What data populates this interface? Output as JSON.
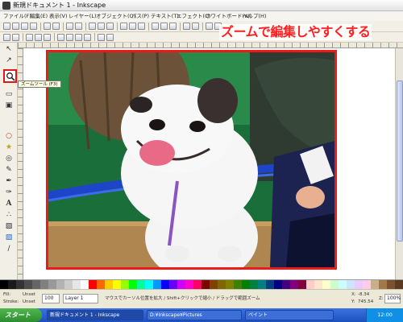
{
  "window": {
    "title": "新規ドキュメント 1 - Inkscape"
  },
  "menu": {
    "items": [
      "ファイル(F)",
      "編集(E)",
      "表示(V)",
      "レイヤー(L)",
      "オブジェクト(O)",
      "パス(P)",
      "テキスト(T)",
      "エフェクト(C)",
      "ホワイトボード(W)",
      "ヘルプ(H)"
    ]
  },
  "annotation": {
    "text": "ズームで編集しやすくする",
    "color": "#ff1f1f"
  },
  "toolbox": {
    "tools": [
      "select-icon",
      "node-edit-icon",
      "tweak-icon",
      "zoom-icon",
      "rectangle-icon",
      "box3d-icon",
      "ellipse-icon",
      "star-icon",
      "spiral-icon",
      "pencil-icon",
      "pen-icon",
      "calligraphy-icon",
      "text-icon",
      "spray-icon",
      "eraser-icon",
      "bucket-icon",
      "dropper-icon"
    ],
    "zoom_tooltip": "ズームツール (F3)"
  },
  "canvas": {
    "selection_color": "#ee1a1a",
    "image": "dog-photo"
  },
  "palette": {
    "colors": [
      "#000000",
      "#1a1a1a",
      "#333333",
      "#4d4d4d",
      "#666666",
      "#808080",
      "#999999",
      "#b3b3b3",
      "#cccccc",
      "#e6e6e6",
      "#ffffff",
      "#ff0000",
      "#ff6600",
      "#ffcc00",
      "#ffff00",
      "#99ff00",
      "#00ff00",
      "#00ff99",
      "#00ffff",
      "#0099ff",
      "#0000ff",
      "#6600ff",
      "#cc00ff",
      "#ff00cc",
      "#ff0066",
      "#800000",
      "#804000",
      "#806600",
      "#808000",
      "#408000",
      "#008000",
      "#008040",
      "#008080",
      "#004080",
      "#000080",
      "#400080",
      "#800080",
      "#800040",
      "#ffcccc",
      "#ffe6cc",
      "#ffffcc",
      "#ccffcc",
      "#ccffff",
      "#cce6ff",
      "#e6ccff",
      "#ffccee",
      "#c8b08a",
      "#a0784a",
      "#7a5230",
      "#5a3a20"
    ]
  },
  "status": {
    "fill_label": "Fill:",
    "stroke_label": "Stroke:",
    "fill_value": "Unset",
    "stroke_value": "Unset",
    "opacity": "100",
    "layer": "Layer 1",
    "message": "マウスでカーソル位置を拡大 / Shift+クリックで縮小 / ドラッグで範囲ズーム",
    "cursor_x_label": "X:",
    "cursor_y_label": "Y:",
    "cursor_x": "-8.34",
    "cursor_y": "745.54",
    "zoom_label": "Z:",
    "zoom": "100%"
  },
  "taskbar": {
    "start_label": "スタート",
    "tasks": [
      "新規ドキュメント 1 - Inkscape",
      "D:¥Inkscape¥Pictures",
      "ペイント"
    ],
    "clock": "12:00"
  }
}
